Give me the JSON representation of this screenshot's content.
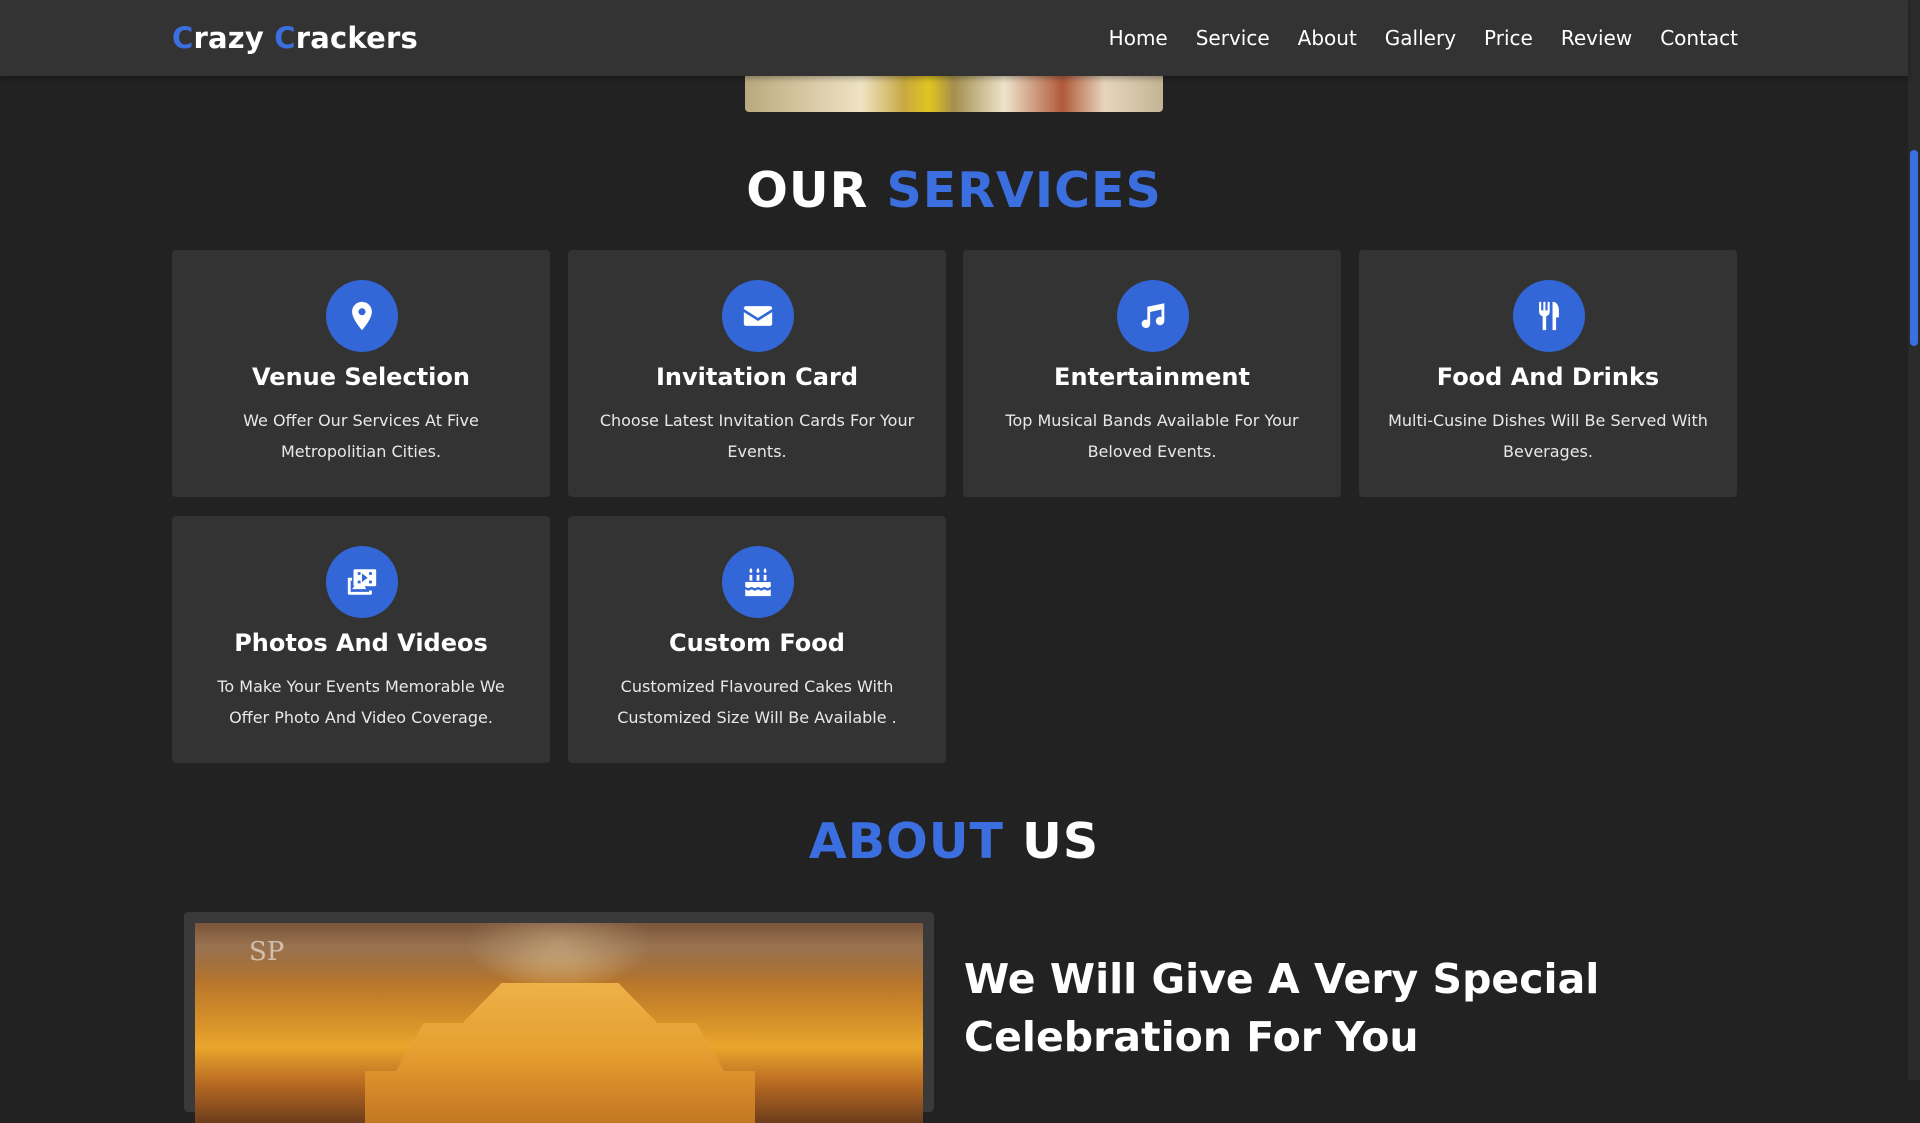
{
  "header": {
    "logo": {
      "word1_initial": "C",
      "word1_rest": "razy ",
      "word2_initial": "C",
      "word2_rest": "rackers"
    },
    "nav": [
      "Home",
      "Service",
      "About",
      "Gallery",
      "Price",
      "Review",
      "Contact"
    ]
  },
  "services": {
    "title_part1": "OUR",
    "title_part2": "SERVICES",
    "cards": [
      {
        "icon": "map-marker-icon",
        "title": "Venue Selection",
        "text": "We Offer Our Services At Five Metropolitian Cities."
      },
      {
        "icon": "envelope-icon",
        "title": "Invitation Card",
        "text": "Choose Latest Invitation Cards For Your Events."
      },
      {
        "icon": "music-icon",
        "title": "Entertainment",
        "text": "Top Musical Bands Available For Your Beloved Events."
      },
      {
        "icon": "utensils-icon",
        "title": "Food And Drinks",
        "text": "Multi-Cusine Dishes Will Be Served With Beverages."
      },
      {
        "icon": "photo-video-icon",
        "title": "Photos And Videos",
        "text": "To Make Your Events Memorable We Offer Photo And Video Coverage."
      },
      {
        "icon": "birthday-cake-icon",
        "title": "Custom Food",
        "text": "Customized Flavoured Cakes With Customized Size Will Be Available ."
      }
    ]
  },
  "about": {
    "title_part1": "ABOUT",
    "title_part2": "US",
    "heading": "We Will Give A Very Special Celebration For You"
  },
  "colors": {
    "accent": "#3b6fe0",
    "background": "#222222",
    "card": "#333333"
  }
}
